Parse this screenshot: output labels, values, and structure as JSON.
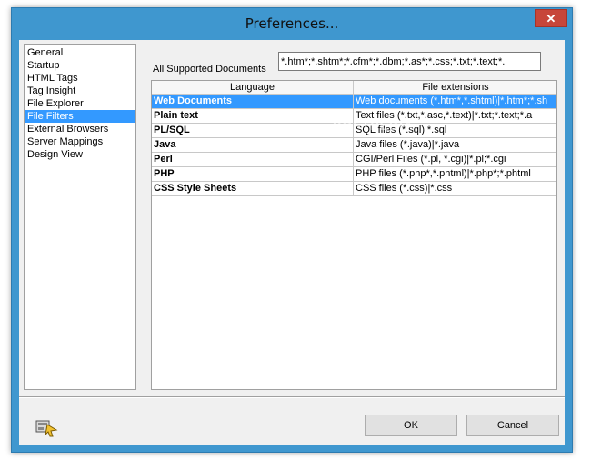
{
  "window": {
    "title": "Preferences...",
    "close_glyph": "✕"
  },
  "nav": {
    "items": [
      "General",
      "Startup",
      "HTML Tags",
      "Tag Insight",
      "File Explorer",
      "File Filters",
      "External Browsers",
      "Server Mappings",
      "Design View"
    ],
    "selected": "File Filters"
  },
  "all_supported": {
    "label": "All Supported Documents",
    "value": "*.htm*;*.shtm*;*.cfm*;*.dbm;*.as*;*.css;*.txt;*.text;*."
  },
  "grid": {
    "columns": [
      "Language",
      "File extensions"
    ],
    "rows": [
      {
        "language": "Web Documents",
        "extensions": "Web documents (*.htm*,*.shtml)|*.htm*;*.sh",
        "selected": true
      },
      {
        "language": "Plain text",
        "extensions": "Text files (*.txt,*.asc,*.text)|*.txt;*.text;*.a"
      },
      {
        "language": "PL/SQL",
        "extensions": "SQL files (*.sql)|*.sql"
      },
      {
        "language": "Java",
        "extensions": "Java files (*.java)|*.java"
      },
      {
        "language": "Perl",
        "extensions": "CGI/Perl Files (*.pl, *.cgi)|*.pl;*.cgi"
      },
      {
        "language": "PHP",
        "extensions": "PHP files (*.php*,*.phtml)|*.php*;*.phtml"
      },
      {
        "language": "CSS Style Sheets",
        "extensions": "CSS files (*.css)|*.css"
      }
    ]
  },
  "watermark": "SOFTPEDIA",
  "buttons": {
    "ok": "OK",
    "cancel": "Cancel"
  },
  "icons": {
    "help": "help-wizard-icon"
  },
  "colors": {
    "titlebar": "#3f97cf",
    "selection": "#3399ff",
    "close": "#c7463a"
  }
}
